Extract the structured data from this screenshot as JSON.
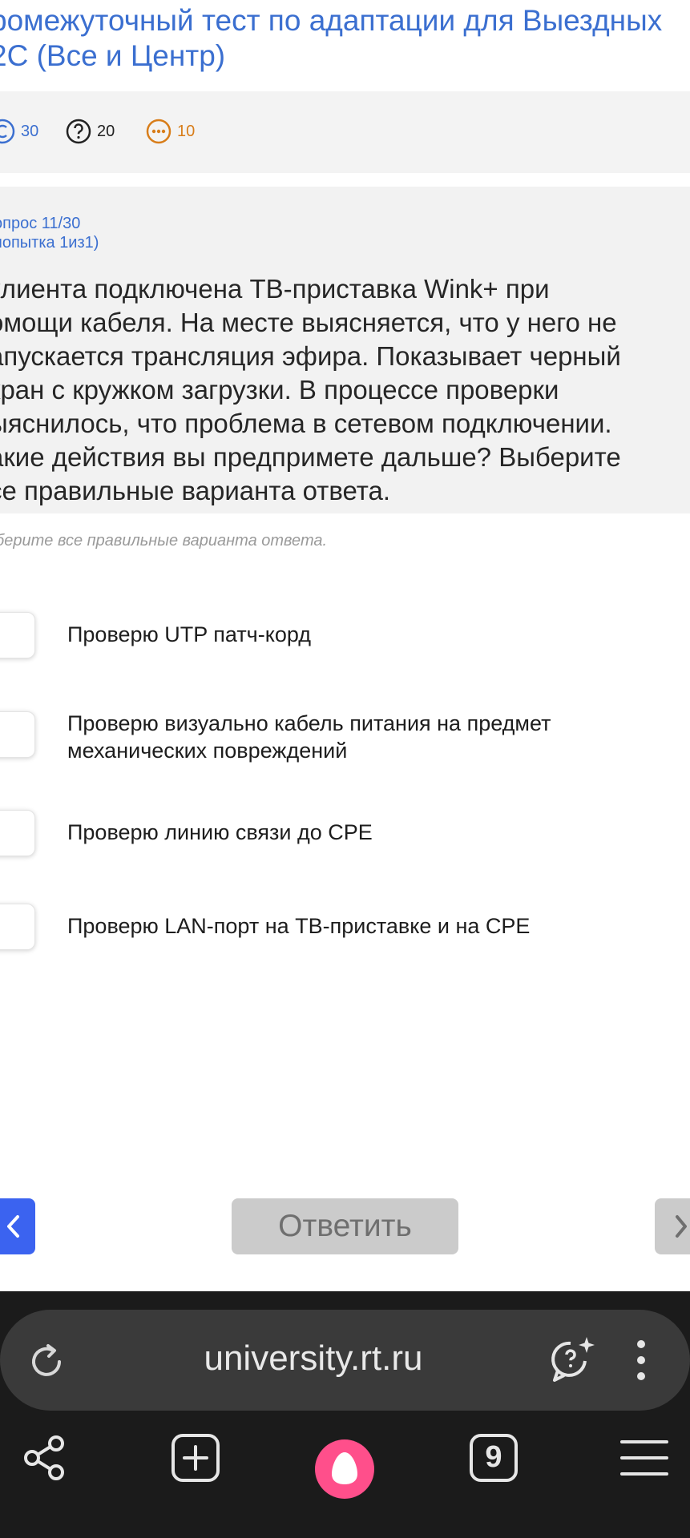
{
  "page": {
    "title_line1": "ромежуточный тест по адаптации для Выездных",
    "title_line2": "2С (Все и Центр)"
  },
  "stats": {
    "total": "30",
    "unanswered": "20",
    "other": "10"
  },
  "question": {
    "number": "опрос 11/30",
    "attempt": "попытка 1из1)",
    "text": "клиента подключена ТВ-приставка Wink+ при\nомощи кабеля. На месте выясняется, что у него не\nапускается трансляция эфира. Показывает черный\nкран с кружком загрузки. В процессе проверки\nыяснилось, что проблема в сетевом подключении.\nакие действия вы предпримете дальше? Выберите\nсе правильные варианта ответа.",
    "hint": "берите все правильные варианта ответа."
  },
  "options": [
    "Проверю UTP патч-корд",
    "Проверю визуально кабель питания на предмет механических повреждений",
    "Проверю линию связи до CPE",
    "Проверю LAN-порт на ТВ-приставке и на CPE"
  ],
  "actions": {
    "answer_label": "Ответить"
  },
  "browser": {
    "url": "university.rt.ru",
    "tabs_count": "9"
  },
  "colors": {
    "accent": "#3b6fd0",
    "prev_button": "#3b63f0",
    "alice": "#ff4f8b"
  }
}
